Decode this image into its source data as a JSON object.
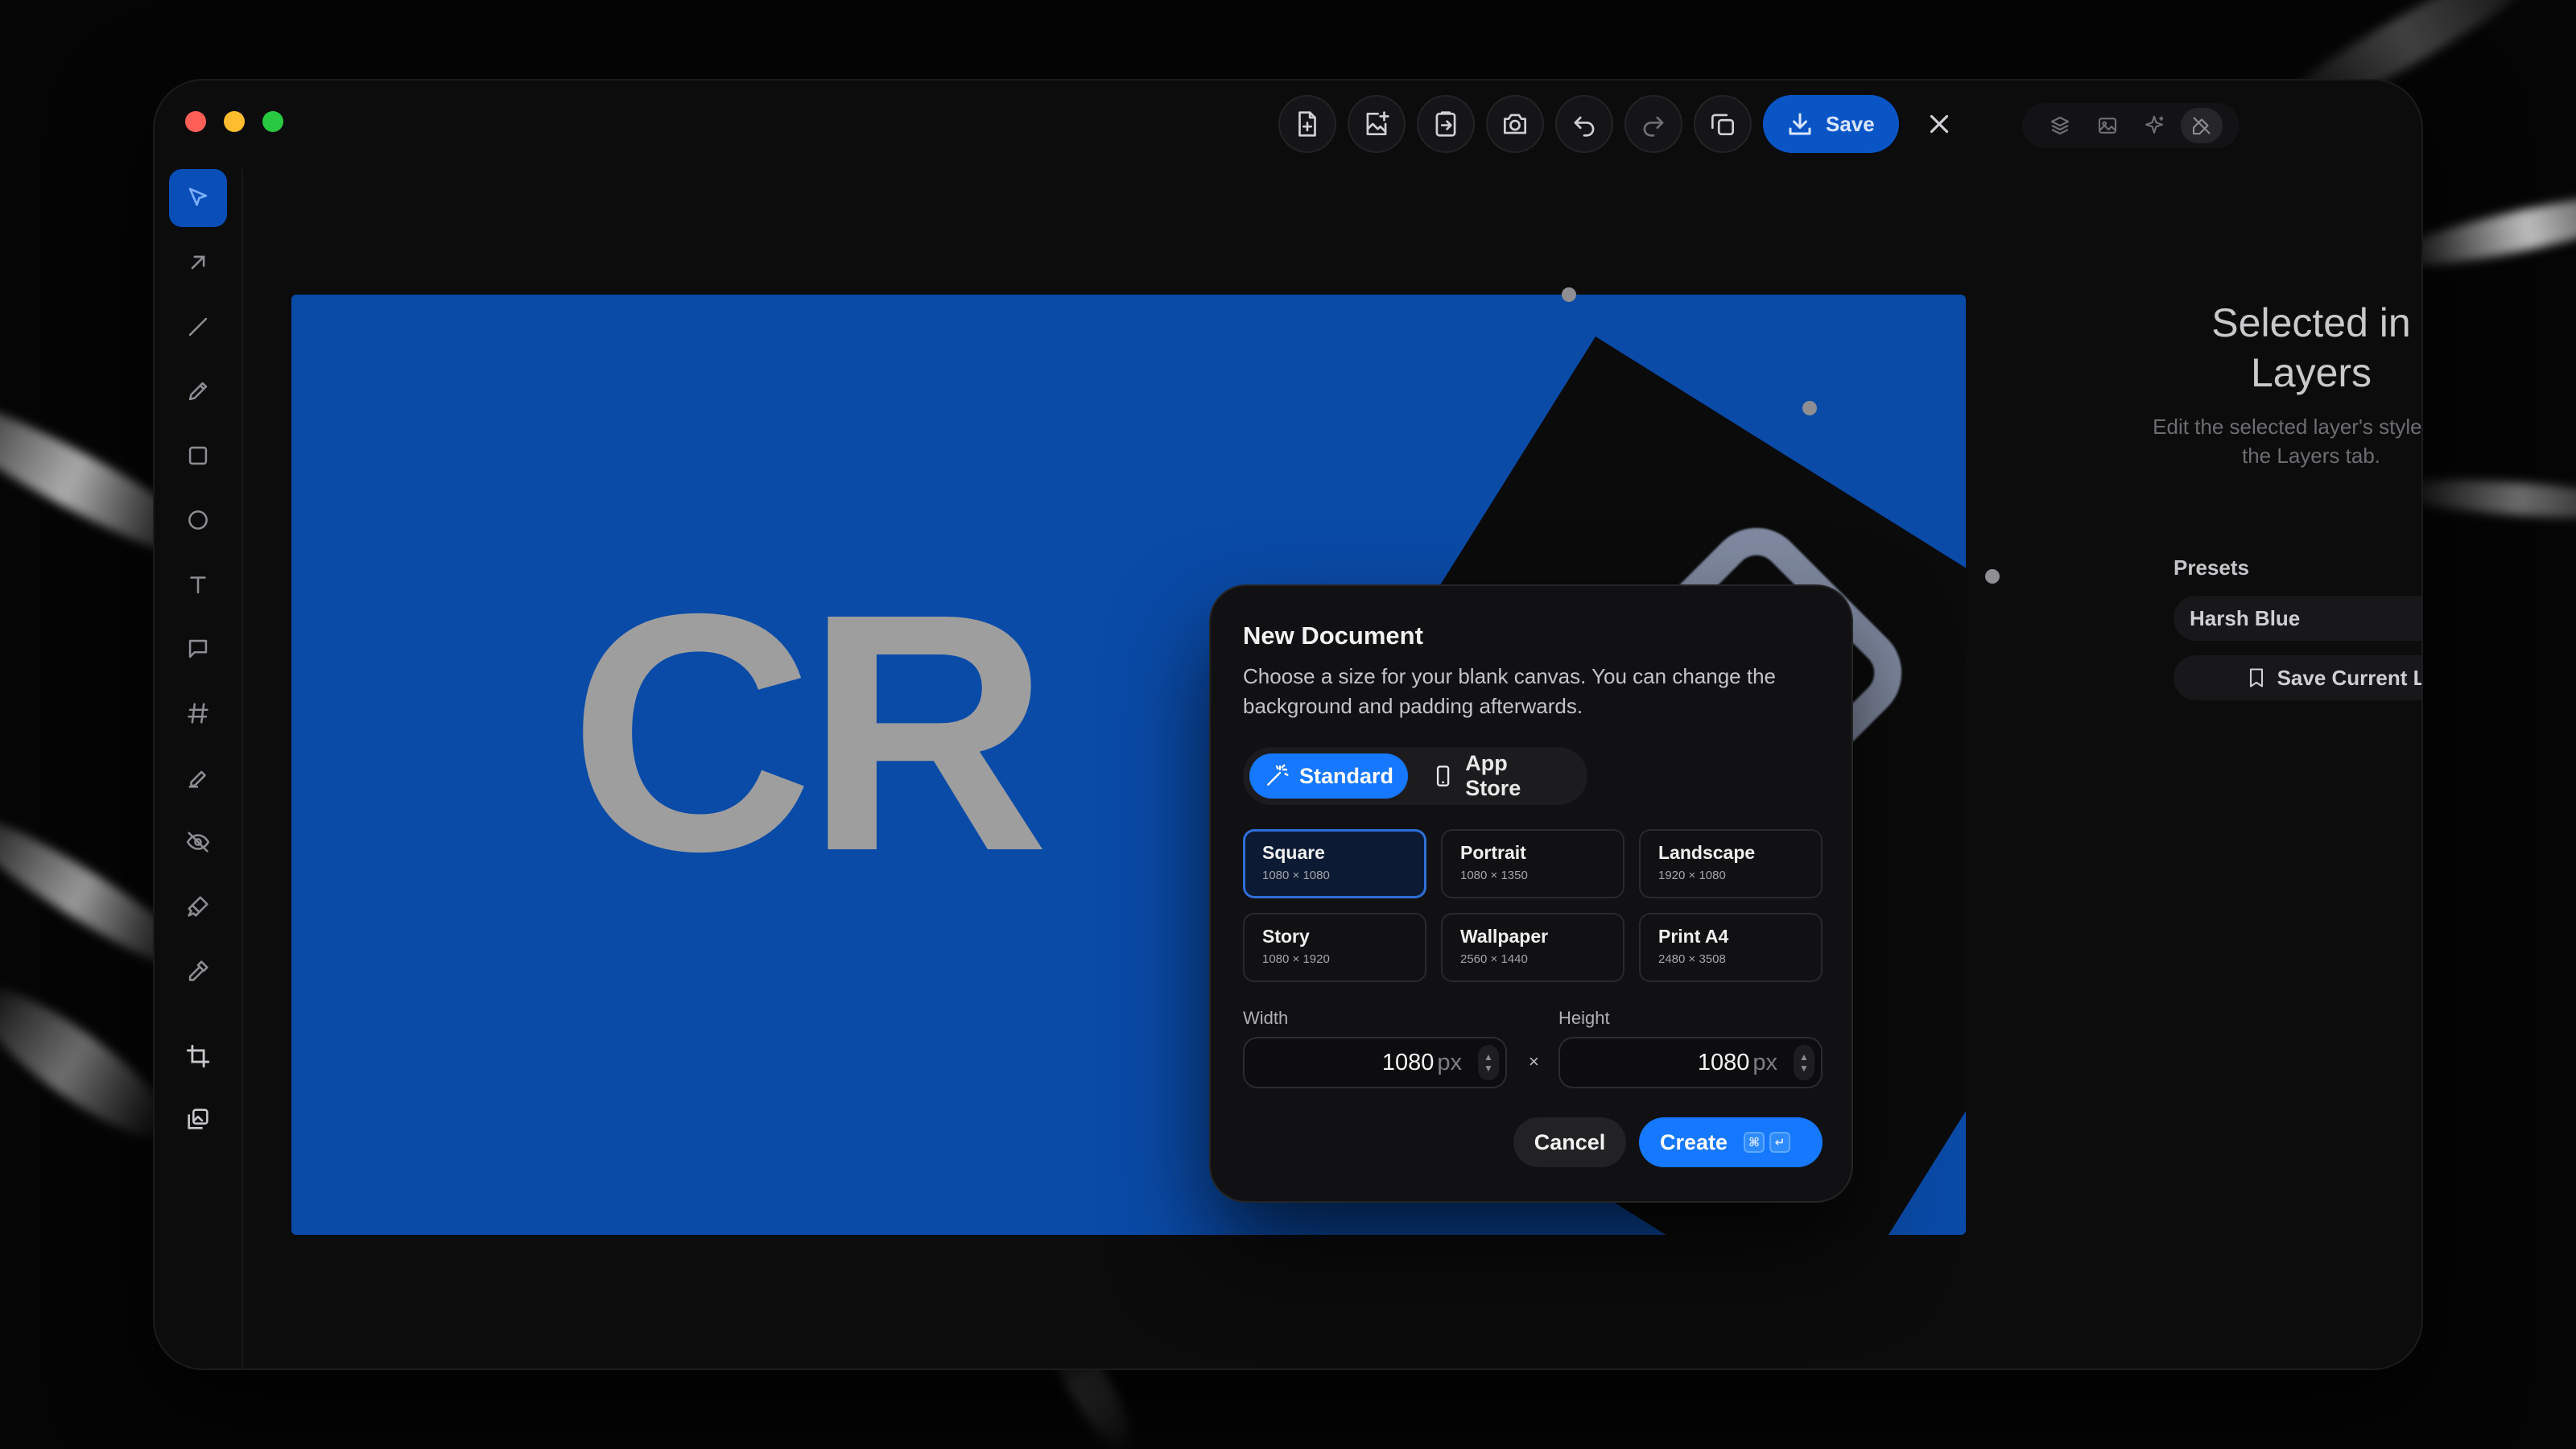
{
  "toolbar": {
    "save_label": "Save"
  },
  "dialog": {
    "title": "New Document",
    "description": "Choose a size for your blank canvas. You can change the background and padding afterwards.",
    "tabs": [
      {
        "label": "Standard",
        "active": true
      },
      {
        "label": "App Store",
        "active": false
      }
    ],
    "presets": [
      {
        "name": "Square",
        "size": "1080 × 1080",
        "active": true
      },
      {
        "name": "Portrait",
        "size": "1080 × 1350",
        "active": false
      },
      {
        "name": "Landscape",
        "size": "1920 × 1080",
        "active": false
      },
      {
        "name": "Story",
        "size": "1080 × 1920",
        "active": false
      },
      {
        "name": "Wallpaper",
        "size": "2560 × 1440",
        "active": false
      },
      {
        "name": "Print A4",
        "size": "2480 × 3508",
        "active": false
      }
    ],
    "width_label": "Width",
    "height_label": "Height",
    "width_value": "1080",
    "height_value": "1080",
    "unit": "px",
    "times": "×",
    "cancel_label": "Cancel",
    "create_label": "Create",
    "create_shortcut": [
      "⌘",
      "↵"
    ]
  },
  "canvas": {
    "text": "CR",
    "background_color": "#0a4ba8"
  },
  "right_panel": {
    "title": "Selected in Layers",
    "subtitle": "Edit the selected layer's style from the Layers tab.",
    "presets_label": "Presets",
    "preset_name": "Harsh Blue",
    "save_look_label": "Save Current Look..."
  },
  "colors": {
    "accent": "#1677ff",
    "save_button": "#0a55c6",
    "window_bg": "#0c0c0d"
  },
  "icons": {
    "traffic_lights": [
      "close-light",
      "minimize-light",
      "zoom-light"
    ],
    "toolbar": [
      "new-file-icon",
      "add-image-icon",
      "export-icon",
      "camera-icon",
      "undo-icon",
      "redo-icon",
      "duplicate-icon",
      "download-icon",
      "close-icon"
    ],
    "panel_tabs": [
      "layers-icon",
      "image-icon",
      "sparkles-icon",
      "style-brush-icon"
    ],
    "sidebar_tools": [
      "select-pointer-icon",
      "arrow-icon",
      "line-icon",
      "pencil-icon",
      "rectangle-icon",
      "ellipse-icon",
      "text-icon",
      "comment-icon",
      "hash-icon",
      "highlighter-icon",
      "hide-eye-icon",
      "paint-brush-icon",
      "eyedropper-icon",
      "crop-icon",
      "insert-image-icon"
    ]
  }
}
